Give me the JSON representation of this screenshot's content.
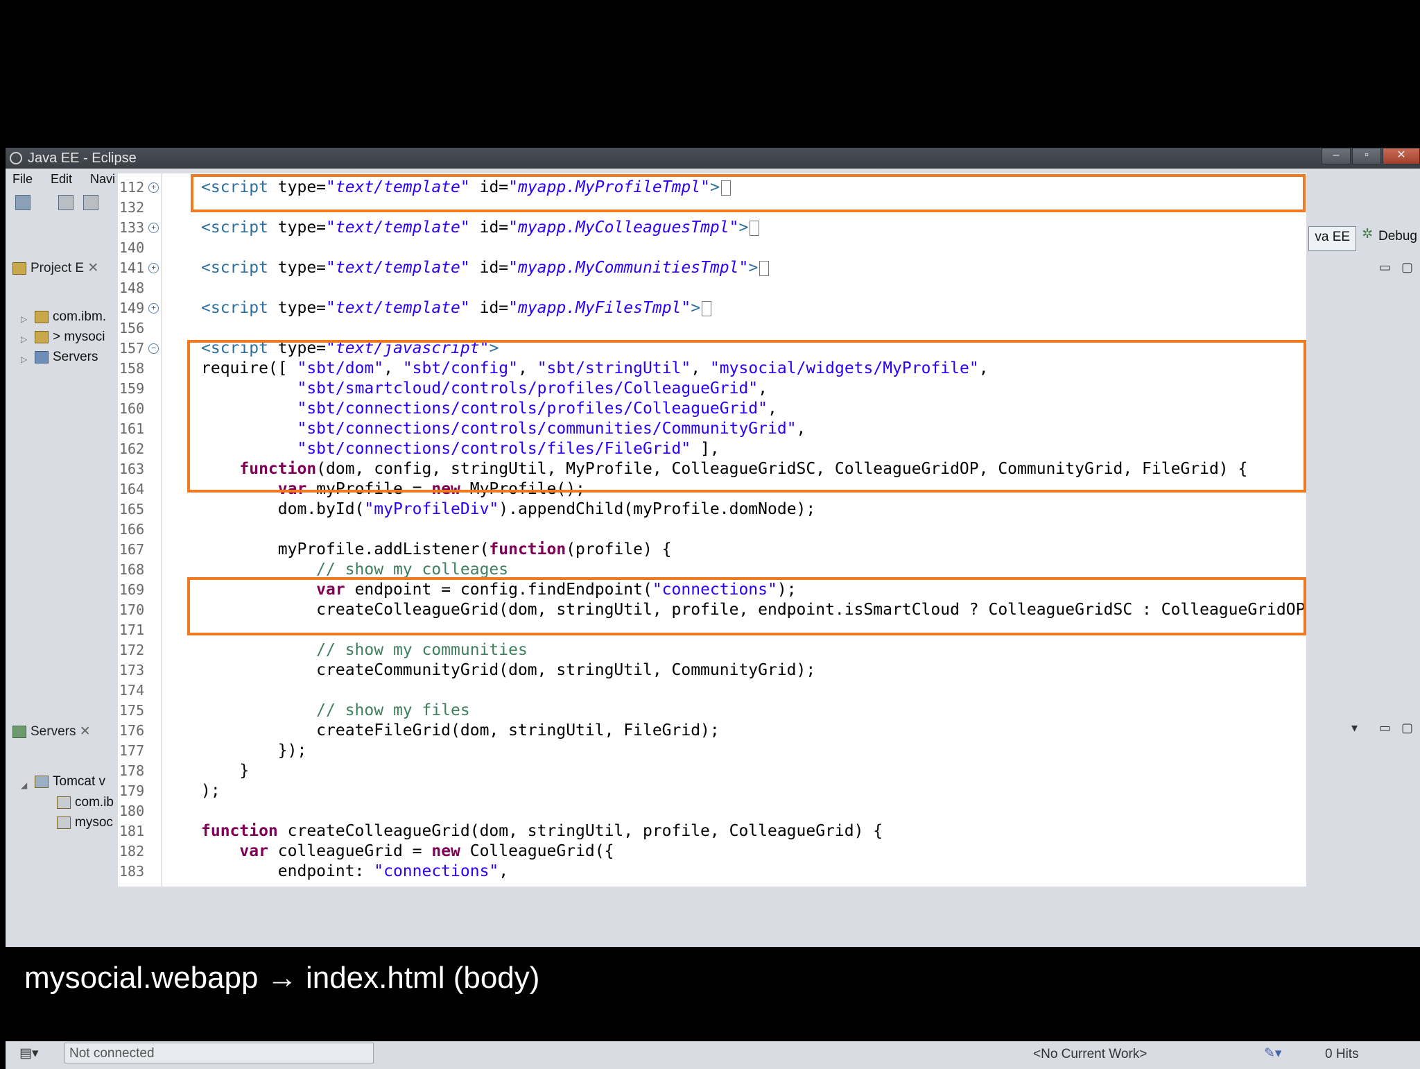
{
  "window": {
    "title": "Java EE - Eclipse"
  },
  "menu": [
    "File",
    "Edit",
    "Navi"
  ],
  "perspective": {
    "java_ee": "va EE",
    "debug": "Debug"
  },
  "project_explorer": {
    "title": "Project E",
    "items": [
      "com.ibm.",
      "> mysoci",
      "Servers"
    ]
  },
  "servers_view": {
    "title": "Servers",
    "items": [
      "Tomcat v",
      "com.ib",
      "mysoc"
    ]
  },
  "status": {
    "connection": "Not connected",
    "work": "<No Current Work>",
    "hits": "0 Hits"
  },
  "editor": {
    "lines": [
      {
        "n": "112",
        "fold": "plus",
        "segs": [
          [
            "tag",
            "<script "
          ],
          [
            "plain",
            "type="
          ],
          [
            "istr",
            "\"text/template\""
          ],
          [
            "plain",
            " id="
          ],
          [
            "istr",
            "\"myapp.MyProfileTmpl\""
          ],
          [
            "tag",
            ">"
          ],
          [
            "box",
            ""
          ]
        ]
      },
      {
        "n": "132",
        "segs": []
      },
      {
        "n": "133",
        "fold": "plus",
        "segs": [
          [
            "tag",
            "<script "
          ],
          [
            "plain",
            "type="
          ],
          [
            "istr",
            "\"text/template\""
          ],
          [
            "plain",
            " id="
          ],
          [
            "istr",
            "\"myapp.MyColleaguesTmpl\""
          ],
          [
            "tag",
            ">"
          ],
          [
            "box",
            ""
          ]
        ]
      },
      {
        "n": "140",
        "segs": []
      },
      {
        "n": "141",
        "fold": "plus",
        "segs": [
          [
            "tag",
            "<script "
          ],
          [
            "plain",
            "type="
          ],
          [
            "istr",
            "\"text/template\""
          ],
          [
            "plain",
            " id="
          ],
          [
            "istr",
            "\"myapp.MyCommunitiesTmpl\""
          ],
          [
            "tag",
            ">"
          ],
          [
            "box",
            ""
          ]
        ]
      },
      {
        "n": "148",
        "segs": []
      },
      {
        "n": "149",
        "fold": "plus",
        "segs": [
          [
            "tag",
            "<script "
          ],
          [
            "plain",
            "type="
          ],
          [
            "istr",
            "\"text/template\""
          ],
          [
            "plain",
            " id="
          ],
          [
            "istr",
            "\"myapp.MyFilesTmpl\""
          ],
          [
            "tag",
            ">"
          ],
          [
            "box",
            ""
          ]
        ]
      },
      {
        "n": "156",
        "segs": []
      },
      {
        "n": "157",
        "fold": "minus",
        "segs": [
          [
            "tag",
            "<script "
          ],
          [
            "plain",
            "type="
          ],
          [
            "istr",
            "\"text/javascript\""
          ],
          [
            "tag",
            ">"
          ]
        ]
      },
      {
        "n": "158",
        "segs": [
          [
            "plain",
            "require([ "
          ],
          [
            "str",
            "\"sbt/dom\""
          ],
          [
            "plain",
            ", "
          ],
          [
            "str",
            "\"sbt/config\""
          ],
          [
            "plain",
            ", "
          ],
          [
            "str",
            "\"sbt/stringUtil\""
          ],
          [
            "plain",
            ", "
          ],
          [
            "str",
            "\"mysocial/widgets/MyProfile\""
          ],
          [
            "plain",
            ","
          ]
        ]
      },
      {
        "n": "159",
        "segs": [
          [
            "plain",
            "          "
          ],
          [
            "str",
            "\"sbt/smartcloud/controls/profiles/ColleagueGrid\""
          ],
          [
            "plain",
            ","
          ]
        ]
      },
      {
        "n": "160",
        "segs": [
          [
            "plain",
            "          "
          ],
          [
            "str",
            "\"sbt/connections/controls/profiles/ColleagueGrid\""
          ],
          [
            "plain",
            ","
          ]
        ]
      },
      {
        "n": "161",
        "segs": [
          [
            "plain",
            "          "
          ],
          [
            "str",
            "\"sbt/connections/controls/communities/CommunityGrid\""
          ],
          [
            "plain",
            ","
          ]
        ]
      },
      {
        "n": "162",
        "segs": [
          [
            "plain",
            "          "
          ],
          [
            "str",
            "\"sbt/connections/controls/files/FileGrid\""
          ],
          [
            "plain",
            " ],"
          ]
        ]
      },
      {
        "n": "163",
        "segs": [
          [
            "plain",
            "    "
          ],
          [
            "kw",
            "function"
          ],
          [
            "plain",
            "(dom, config, stringUtil, MyProfile, ColleagueGridSC, ColleagueGridOP, CommunityGrid, FileGrid) {"
          ]
        ]
      },
      {
        "n": "164",
        "segs": [
          [
            "plain",
            "        "
          ],
          [
            "kw",
            "var"
          ],
          [
            "plain",
            " myProfile = "
          ],
          [
            "kw",
            "new"
          ],
          [
            "plain",
            " MyProfile();"
          ]
        ]
      },
      {
        "n": "165",
        "segs": [
          [
            "plain",
            "        dom.byId("
          ],
          [
            "str",
            "\"myProfileDiv\""
          ],
          [
            "plain",
            ").appendChild(myProfile.domNode);"
          ]
        ]
      },
      {
        "n": "166",
        "segs": []
      },
      {
        "n": "167",
        "segs": [
          [
            "plain",
            "        myProfile.addListener("
          ],
          [
            "kw",
            "function"
          ],
          [
            "plain",
            "(profile) {"
          ]
        ]
      },
      {
        "n": "168",
        "segs": [
          [
            "plain",
            "            "
          ],
          [
            "cm",
            "// show my colleages"
          ]
        ]
      },
      {
        "n": "169",
        "segs": [
          [
            "plain",
            "            "
          ],
          [
            "kw",
            "var"
          ],
          [
            "plain",
            " endpoint = config.findEndpoint("
          ],
          [
            "str",
            "\"connections\""
          ],
          [
            "plain",
            ");"
          ]
        ]
      },
      {
        "n": "170",
        "segs": [
          [
            "plain",
            "            createColleagueGrid(dom, stringUtil, profile, endpoint.isSmartCloud ? ColleagueGridSC : ColleagueGridOP);"
          ]
        ]
      },
      {
        "n": "171",
        "segs": []
      },
      {
        "n": "172",
        "segs": [
          [
            "plain",
            "            "
          ],
          [
            "cm",
            "// show my communities"
          ]
        ]
      },
      {
        "n": "173",
        "segs": [
          [
            "plain",
            "            createCommunityGrid(dom, stringUtil, CommunityGrid);"
          ]
        ]
      },
      {
        "n": "174",
        "segs": []
      },
      {
        "n": "175",
        "segs": [
          [
            "plain",
            "            "
          ],
          [
            "cm",
            "// show my files"
          ]
        ]
      },
      {
        "n": "176",
        "segs": [
          [
            "plain",
            "            createFileGrid(dom, stringUtil, FileGrid);"
          ]
        ]
      },
      {
        "n": "177",
        "segs": [
          [
            "plain",
            "        });"
          ]
        ]
      },
      {
        "n": "178",
        "segs": [
          [
            "plain",
            "    }"
          ]
        ]
      },
      {
        "n": "179",
        "segs": [
          [
            "plain",
            ");"
          ]
        ]
      },
      {
        "n": "180",
        "segs": []
      },
      {
        "n": "181",
        "segs": [
          [
            "kw",
            "function"
          ],
          [
            "plain",
            " createColleagueGrid(dom, stringUtil, profile, ColleagueGrid) {"
          ]
        ]
      },
      {
        "n": "182",
        "segs": [
          [
            "plain",
            "    "
          ],
          [
            "kw",
            "var"
          ],
          [
            "plain",
            " colleagueGrid = "
          ],
          [
            "kw",
            "new"
          ],
          [
            "plain",
            " ColleagueGrid({"
          ]
        ]
      },
      {
        "n": "183",
        "segs": [
          [
            "plain",
            "        endpoint: "
          ],
          [
            "str",
            "\"connections\""
          ],
          [
            "plain",
            ","
          ]
        ]
      }
    ]
  },
  "caption": "mysocial.webapp → index.html (body)"
}
